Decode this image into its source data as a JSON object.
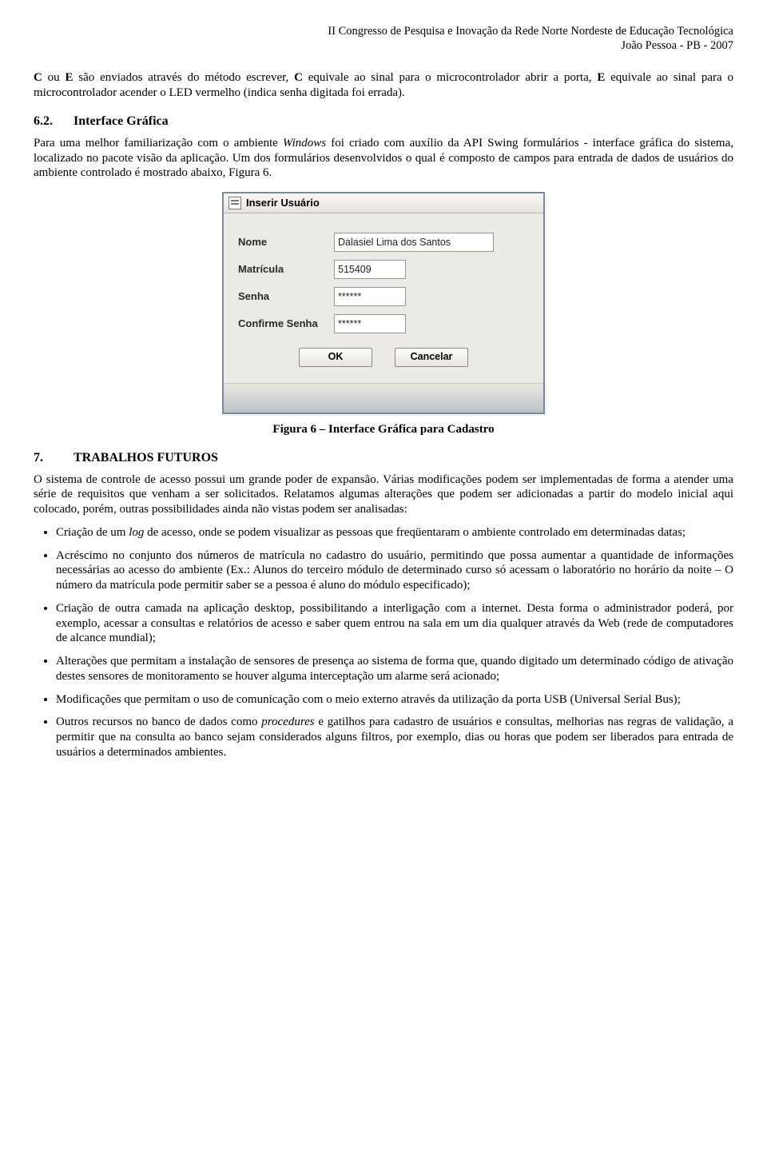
{
  "header": {
    "line1": "II Congresso de Pesquisa e Inovação da Rede Norte Nordeste de Educação Tecnológica",
    "line2": "João Pessoa - PB  - 2007"
  },
  "para1_prefix": "C",
  "para1_mid1": " ou ",
  "para1_bold2": "E",
  "para1_mid2": " são enviados através do método escrever, ",
  "para1_bold3": "C",
  "para1_mid3": " equivale ao sinal para o microcontrolador abrir a porta, ",
  "para1_bold4": "E",
  "para1_mid4": " equivale ao sinal para o microcontrolador acender o LED vermelho (indica senha digitada foi errada).",
  "sec62_num": "6.2.",
  "sec62_title": "Interface Gráfica",
  "para2a": "Para uma melhor familiarização com o ambiente ",
  "para2_italic": "Windows",
  "para2b": " foi criado com auxílio da API Swing formulários - interface gráfica do sistema, localizado no pacote visão da aplicação. Um dos formulários desenvolvidos o qual é composto de campos para entrada de dados de usuários do ambiente controlado é mostrado abaixo, Figura 6.",
  "dialog": {
    "title": "Inserir Usuário",
    "labels": {
      "nome": "Nome",
      "matricula": "Matrícula",
      "senha": "Senha",
      "confirme": "Confirme Senha"
    },
    "values": {
      "nome": "Dalasiel Lima dos Santos",
      "matricula": "515409",
      "senha": "******",
      "confirme": "******"
    },
    "buttons": {
      "ok": "OK",
      "cancel": "Cancelar"
    }
  },
  "figure_caption": "Figura 6 – Interface Gráfica para Cadastro",
  "sec7_num": "7.",
  "sec7_title": "TRABALHOS FUTUROS",
  "para3": "O sistema de controle de acesso possui um grande poder de expansão. Várias modificações podem ser implementadas de forma a atender uma série de requisitos que venham a ser solicitados. Relatamos algumas alterações que podem ser adicionadas a partir do modelo inicial aqui colocado, porém, outras possibilidades ainda não vistas podem ser analisadas:",
  "bullets": {
    "b1a": "Criação de um ",
    "b1_italic": "log",
    "b1b": " de acesso, onde se podem visualizar as pessoas que freqüentaram o ambiente controlado em determinadas datas;",
    "b2": "Acréscimo no conjunto dos números de matrícula no cadastro do usuário, permitindo que possa aumentar a quantidade de informações necessárias ao acesso do ambiente (Ex.: Alunos do terceiro módulo de determinado curso só acessam o laboratório no horário da noite – O número da matrícula pode permitir saber se a pessoa é aluno do módulo especificado);",
    "b3": "Criação de outra camada na aplicação desktop, possibilitando a interligação com a internet. Desta forma o administrador poderá, por exemplo, acessar a consultas e relatórios de acesso e saber quem entrou na sala em um dia qualquer através da Web (rede de computadores de alcance mundial);",
    "b4": "Alterações que permitam a instalação de sensores de presença ao sistema de forma que, quando digitado um determinado código de ativação destes sensores de monitoramento se houver alguma interceptação um alarme será acionado;",
    "b5": "Modificações que permitam o uso de comunicação com o meio externo através da utilização da porta USB (Universal Serial Bus);",
    "b6a": "Outros recursos no banco de dados como ",
    "b6_italic": "procedures",
    "b6b": " e gatilhos para cadastro de usuários e consultas, melhorias nas regras de validação, a permitir que na consulta ao banco sejam considerados alguns filtros, por exemplo, dias ou horas que podem ser liberados para entrada de usuários a determinados ambientes."
  }
}
